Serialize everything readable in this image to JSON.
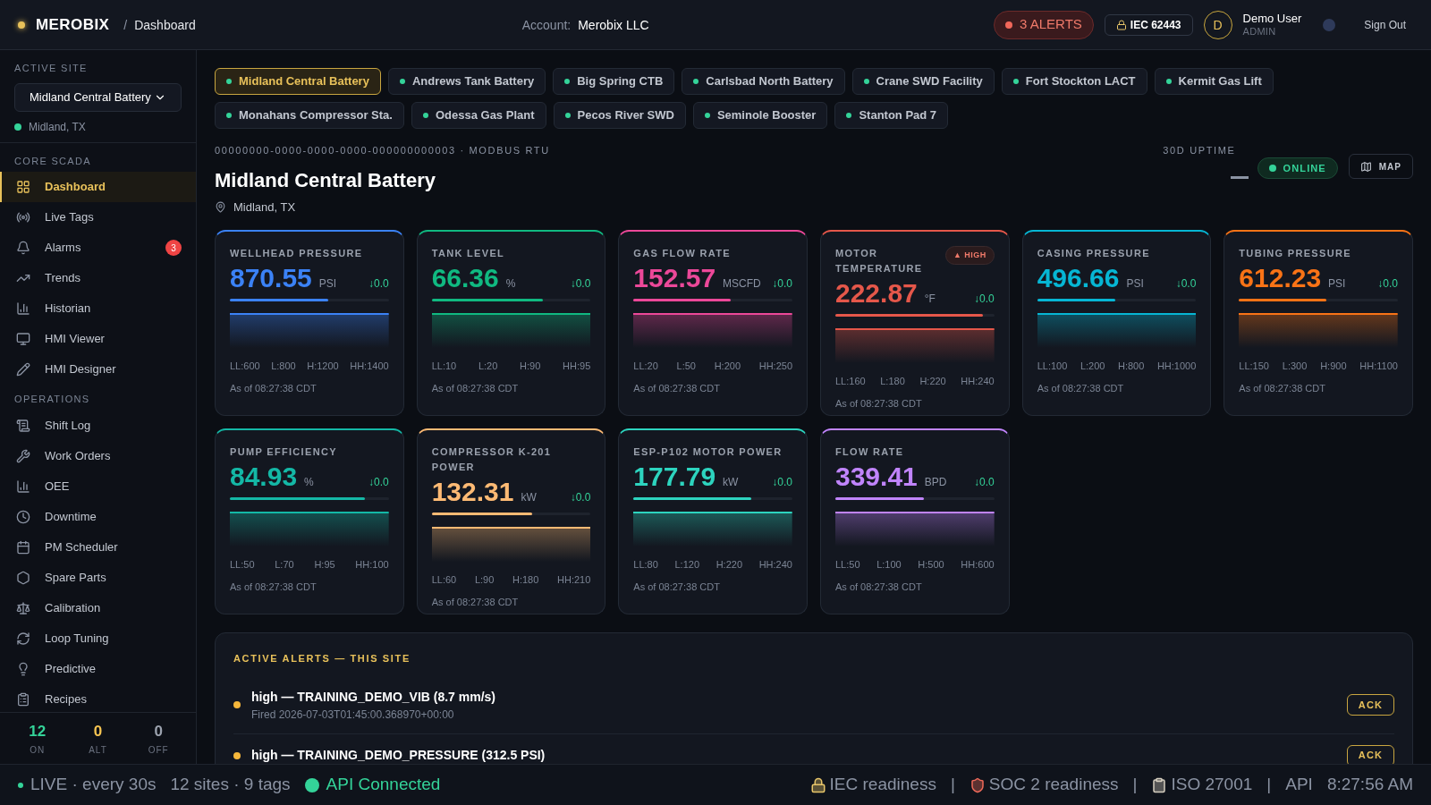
{
  "header": {
    "brand": "MEROBIX",
    "separator": "/",
    "page": "Dashboard",
    "account_label": "Account:",
    "account": "Merobix LLC",
    "alerts": "3 ALERTS",
    "compliance": "IEC 62443",
    "avatar": "D",
    "user": "Demo User",
    "role": "ADMIN",
    "sign_out": "Sign Out"
  },
  "sidebar": {
    "site_label": "ACTIVE SITE",
    "site_select": "Midland Central Battery",
    "site_location": "Midland, TX",
    "sections": [
      {
        "title": "CORE SCADA",
        "items": [
          {
            "label": "Dashboard",
            "selected": true
          },
          {
            "label": "Live Tags",
            "selected": false
          },
          {
            "label": "Alarms",
            "selected": false,
            "badge": "3"
          },
          {
            "label": "Trends",
            "selected": false
          },
          {
            "label": "Historian",
            "selected": false
          },
          {
            "label": "HMI Viewer",
            "selected": false
          },
          {
            "label": "HMI Designer",
            "selected": false
          }
        ]
      },
      {
        "title": "OPERATIONS",
        "items": [
          {
            "label": "Shift Log",
            "selected": false
          },
          {
            "label": "Work Orders",
            "selected": false
          },
          {
            "label": "OEE",
            "selected": false
          },
          {
            "label": "Downtime",
            "selected": false
          },
          {
            "label": "PM Scheduler",
            "selected": false
          },
          {
            "label": "Spare Parts",
            "selected": false
          },
          {
            "label": "Calibration",
            "selected": false
          },
          {
            "label": "Loop Tuning",
            "selected": false
          },
          {
            "label": "Predictive",
            "selected": false
          },
          {
            "label": "Recipes",
            "selected": false
          }
        ]
      }
    ],
    "counts": [
      {
        "value": "12",
        "label": "ON",
        "color": "#34d399"
      },
      {
        "value": "0",
        "label": "ALT",
        "color": "#f5c451"
      },
      {
        "value": "0",
        "label": "OFF",
        "color": "#9ca3af"
      }
    ]
  },
  "sites": [
    {
      "name": "Midland Central Battery",
      "selected": true
    },
    {
      "name": "Andrews Tank Battery",
      "selected": false
    },
    {
      "name": "Big Spring CTB",
      "selected": false
    },
    {
      "name": "Carlsbad North Battery",
      "selected": false
    },
    {
      "name": "Crane SWD Facility",
      "selected": false
    },
    {
      "name": "Fort Stockton LACT",
      "selected": false
    },
    {
      "name": "Kermit Gas Lift",
      "selected": false
    },
    {
      "name": "Monahans Compressor Sta.",
      "selected": false
    },
    {
      "name": "Odessa Gas Plant",
      "selected": false
    },
    {
      "name": "Pecos River SWD",
      "selected": false
    },
    {
      "name": "Seminole Booster",
      "selected": false
    },
    {
      "name": "Stanton Pad 7",
      "selected": false
    }
  ],
  "site": {
    "id_line": "00000000-0000-0000-0000-000000000003 · MODBUS RTU",
    "title": "Midland Central Battery",
    "location": "Midland, TX",
    "uptime_label": "30D UPTIME",
    "status": "ONLINE",
    "map": "MAP"
  },
  "metrics": [
    {
      "name": "WELLHEAD PRESSURE",
      "value": "870.55",
      "unit": "PSI",
      "delta": "↓0.0",
      "level": 0.62,
      "color": "#3b82f6",
      "limits": [
        "LL:600",
        "L:800",
        "H:1200",
        "HH:1400"
      ],
      "as_of": "As of 08:27:38 CDT"
    },
    {
      "name": "TANK LEVEL",
      "value": "66.36",
      "unit": "%",
      "delta": "↓0.0",
      "level": 0.7,
      "color": "#10b981",
      "limits": [
        "LL:10",
        "L:20",
        "H:90",
        "HH:95"
      ],
      "as_of": "As of 08:27:38 CDT"
    },
    {
      "name": "GAS FLOW RATE",
      "value": "152.57",
      "unit": "MSCFD",
      "delta": "↓0.0",
      "level": 0.61,
      "color": "#ec4899",
      "limits": [
        "LL:20",
        "L:50",
        "H:200",
        "HH:250"
      ],
      "as_of": "As of 08:27:38 CDT"
    },
    {
      "name": "MOTOR TEMPERATURE",
      "value": "222.87",
      "unit": "°F",
      "delta": "↓0.0",
      "level": 0.93,
      "color": "#e5574a",
      "alarm": "▲ HIGH",
      "limits": [
        "LL:160",
        "L:180",
        "H:220",
        "HH:240"
      ],
      "as_of": "As of 08:27:38 CDT"
    },
    {
      "name": "CASING PRESSURE",
      "value": "496.66",
      "unit": "PSI",
      "delta": "↓0.0",
      "level": 0.49,
      "color": "#06b6d4",
      "limits": [
        "LL:100",
        "L:200",
        "H:800",
        "HH:1000"
      ],
      "as_of": "As of 08:27:38 CDT"
    },
    {
      "name": "TUBING PRESSURE",
      "value": "612.23",
      "unit": "PSI",
      "delta": "↓0.0",
      "level": 0.55,
      "color": "#f97316",
      "limits": [
        "LL:150",
        "L:300",
        "H:900",
        "HH:1100"
      ],
      "as_of": "As of 08:27:38 CDT"
    },
    {
      "name": "PUMP EFFICIENCY",
      "value": "84.93",
      "unit": "%",
      "delta": "↓0.0",
      "level": 0.85,
      "color": "#14b8a6",
      "limits": [
        "LL:50",
        "L:70",
        "H:95",
        "HH:100"
      ],
      "as_of": "As of 08:27:38 CDT"
    },
    {
      "name": "COMPRESSOR K-201 POWER",
      "value": "132.31",
      "unit": "kW",
      "delta": "↓0.0",
      "level": 0.63,
      "color": "#fdba74",
      "limits": [
        "LL:60",
        "L:90",
        "H:180",
        "HH:210"
      ],
      "as_of": "As of 08:27:38 CDT"
    },
    {
      "name": "ESP-P102 MOTOR POWER",
      "value": "177.79",
      "unit": "kW",
      "delta": "↓0.0",
      "level": 0.74,
      "color": "#2dd4bf",
      "limits": [
        "LL:80",
        "L:120",
        "H:220",
        "HH:240"
      ],
      "as_of": "As of 08:27:38 CDT"
    },
    {
      "name": "FLOW RATE",
      "value": "339.41",
      "unit": "BPD",
      "delta": "↓0.0",
      "level": 0.56,
      "color": "#c084fc",
      "limits": [
        "LL:50",
        "L:100",
        "H:500",
        "HH:600"
      ],
      "as_of": "As of 08:27:38 CDT"
    }
  ],
  "alerts": {
    "title": "ACTIVE ALERTS — THIS SITE",
    "items": [
      {
        "title": "high — TRAINING_DEMO_VIB (8.7 mm/s)",
        "fired": "Fired 2026-07-03T01:45:00.368970+00:00",
        "action": "ACK"
      },
      {
        "title": "high — TRAINING_DEMO_PRESSURE (312.5 PSI)",
        "action": "ACK"
      }
    ]
  },
  "status_bar": {
    "live": "LIVE · every 30s",
    "counts": "12 sites · 9 tags",
    "api": "API Connected",
    "right": [
      {
        "kind": "badge",
        "text": "IEC readiness"
      },
      {
        "kind": "separator",
        "text": "|"
      },
      {
        "kind": "badge",
        "text": "SOC 2 readiness"
      },
      {
        "kind": "separator",
        "text": "|"
      },
      {
        "kind": "badge",
        "text": "ISO 27001"
      },
      {
        "kind": "separator",
        "text": "|"
      },
      {
        "kind": "text",
        "text": "API"
      },
      {
        "kind": "text",
        "text": "8:27:56 AM"
      }
    ]
  }
}
